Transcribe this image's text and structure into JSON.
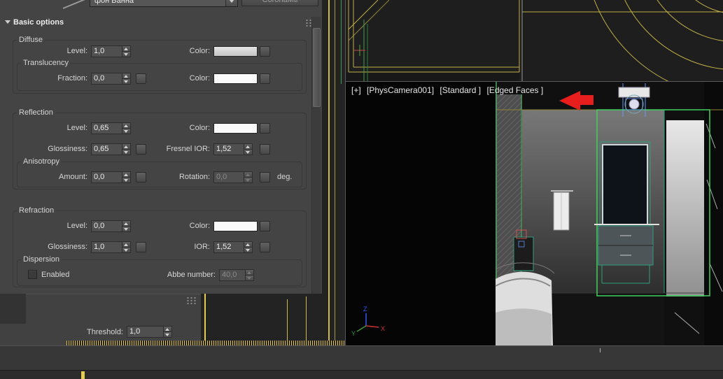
{
  "colors": {
    "panel_bg": "#444444",
    "accent_yellow": "#d9c64c",
    "wire_green": "#3fae5f",
    "selection_green": "#3ed25e",
    "teal_outline": "#2f9f7f",
    "arrow_red": "#e81e1e",
    "axis_x_red": "#cc3333",
    "axis_y_green": "#3a9a3a",
    "axis_z_blue": "#3355ff"
  },
  "toolbar": {
    "material_name": "фон Ванна",
    "material_class_button": "CoronaMtl"
  },
  "rollout": {
    "title": "Basic options"
  },
  "diffuse": {
    "group_label": "Diffuse",
    "level_label": "Level:",
    "level_value": "1,0",
    "color_label": "Color:",
    "translucency": {
      "group_label": "Translucency",
      "fraction_label": "Fraction:",
      "fraction_value": "0,0",
      "color_label": "Color:"
    }
  },
  "reflection": {
    "group_label": "Reflection",
    "level_label": "Level:",
    "level_value": "0,65",
    "color_label": "Color:",
    "glossiness_label": "Glossiness:",
    "glossiness_value": "0,65",
    "fresnel_label": "Fresnel IOR:",
    "fresnel_value": "1,52",
    "anisotropy": {
      "group_label": "Anisotropy",
      "amount_label": "Amount:",
      "amount_value": "0,0",
      "rotation_label": "Rotation:",
      "rotation_value": "0,0",
      "deg_label": "deg."
    }
  },
  "refraction": {
    "group_label": "Refraction",
    "level_label": "Level:",
    "level_value": "0,0",
    "color_label": "Color:",
    "glossiness_label": "Glossiness:",
    "glossiness_value": "1,0",
    "ior_label": "IOR:",
    "ior_value": "1,52",
    "dispersion": {
      "group_label": "Dispersion",
      "enabled_label": "Enabled",
      "abbe_label": "Abbe number:",
      "abbe_value": "40,0"
    }
  },
  "lower_panel": {
    "threshold_label": "Threshold:",
    "threshold_value": "1,0"
  },
  "viewport": {
    "menu_general": "[+]",
    "menu_camera": "[PhysCamera001]",
    "menu_shading": "[Standard ]",
    "menu_faces": "[Edged Faces ]",
    "axis_x": "X",
    "axis_y": "Y",
    "axis_z": "Z"
  }
}
